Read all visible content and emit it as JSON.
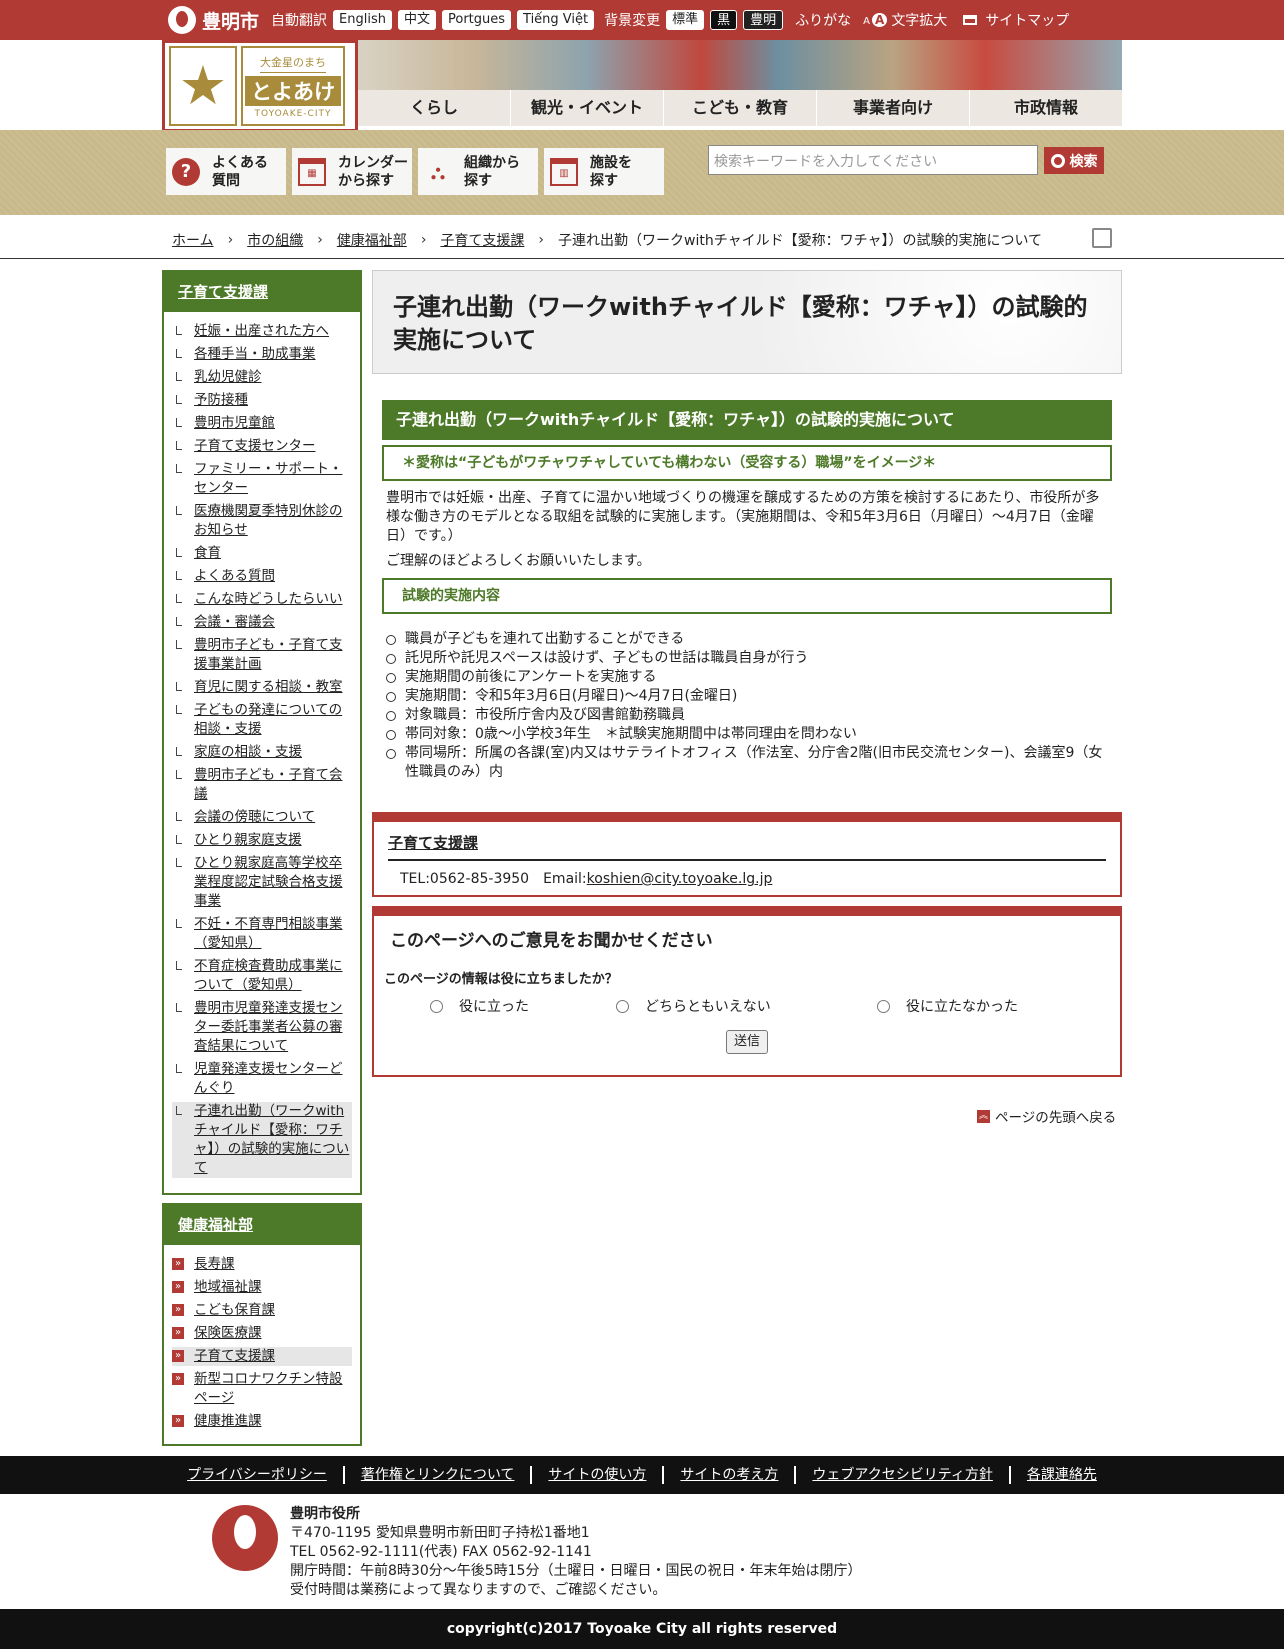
{
  "site": {
    "city": "豊明市",
    "logo_top": "大金星のまち",
    "logo_main": "とよあけ",
    "logo_sub": "TOYOAKE-CITY"
  },
  "topbar": {
    "translate_label": "自動翻訳",
    "languages": [
      "English",
      "中文",
      "Portgues",
      "Tiếng Việt"
    ],
    "bg_label": "背景変更",
    "bg_options": [
      "標準",
      "黒",
      "豊明"
    ],
    "furigana": "ふりがな",
    "zoom": "文字拡大",
    "sitemap": "サイトマップ"
  },
  "global_nav": [
    "くらし",
    "観光・イベント",
    "こども・教育",
    "事業者向け",
    "市政情報"
  ],
  "quick": [
    {
      "label": "よくある\n質問",
      "icon": "question-icon"
    },
    {
      "label": "カレンダー\nから探す",
      "icon": "calendar-icon"
    },
    {
      "label": "組織から\n探す",
      "icon": "org-chart-icon"
    },
    {
      "label": "施設を\n探す",
      "icon": "building-icon"
    }
  ],
  "search": {
    "placeholder": "検索キーワードを入力してください",
    "button": "検索"
  },
  "breadcrumb": [
    "ホーム",
    "市の組織",
    "健康福祉部",
    "子育て支援課",
    "子連れ出勤（ワークwithチャイルド【愛称：ワチャ】）の試験的実施について"
  ],
  "sidebar1": {
    "title": "子育て支援課",
    "items": [
      "妊娠・出産された方へ",
      "各種手当・助成事業",
      "乳幼児健診",
      "予防接種",
      "豊明市児童館",
      "子育て支援センター",
      "ファミリー・サポート・センター",
      "医療機関夏季特別休診のお知らせ",
      "食育",
      "よくある質問",
      "こんな時どうしたらいい",
      "会議・審議会",
      "豊明市子ども・子育て支援事業計画",
      "育児に関する相談・教室",
      "子どもの発達についての相談・支援",
      "家庭の相談・支援",
      "豊明市子ども・子育て会議",
      "会議の傍聴について",
      "ひとり親家庭支援",
      "ひとり親家庭高等学校卒業程度認定試験合格支援事業",
      "不妊・不育専門相談事業（愛知県）",
      "不育症検査費助成事業について（愛知県）",
      "豊明市児童発達支援センター委託事業者公募の審査結果について",
      "児童発達支援センターどんぐり",
      "子連れ出勤（ワークwithチャイルド【愛称：ワチャ】）の試験的実施について"
    ]
  },
  "sidebar2": {
    "title": "健康福祉部",
    "items": [
      "長寿課",
      "地域福祉課",
      "こども保育課",
      "保険医療課",
      "子育て支援課",
      "新型コロナワクチン特設ページ",
      "健康推進課"
    ]
  },
  "page": {
    "title": "子連れ出勤（ワークwithチャイルド【愛称：ワチャ】）の試験的実施について",
    "h2": "子連れ出勤（ワークwithチャイルド【愛称：ワチャ】）の試験的実施について",
    "h3a": "＊愛称は“子どもがワチャワチャしていても構わない（受容する）職場”をイメージ＊",
    "p1": "豊明市では妊娠・出産、子育てに温かい地域づくりの機運を醸成するための方策を検討するにあたり、市役所が多様な働き方のモデルとなる取組を試験的に実施します。（実施期間は、令和5年3月6日（月曜日）～4月7日（金曜日）です。）",
    "p2": "ご理解のほどよろしくお願いいたします。",
    "h3b": "試験的実施内容",
    "bullets": [
      "職員が子どもを連れて出勤することができる",
      "託児所や託児スペースは設けず、子どもの世話は職員自身が行う",
      "実施期間の前後にアンケートを実施する",
      "実施期間：令和5年3月6日(月曜日)～4月7日(金曜日)",
      "対象職員：市役所庁舎内及び図書館勤務職員",
      "帯同対象：0歳～小学校3年生　＊試験実施期間中は帯同理由を問わない",
      "帯同場所：所属の各課(室)内又はサテライトオフィス（作法室、分庁舎2階(旧市民交流センター)、会議室9（女性職員のみ）内"
    ]
  },
  "contact": {
    "name": "子育て支援課",
    "tel": "TEL:0562-85-3950　Email:",
    "email": "koshien@city.toyoake.lg.jp"
  },
  "feedback": {
    "heading": "このページへのご意見をお聞かせください",
    "question": "このページの情報は役に立ちましたか？",
    "options": [
      "役に立った",
      "どちらともいえない",
      "役に立たなかった"
    ],
    "submit": "送信"
  },
  "to_top": "ページの先頭へ戻る",
  "footer_nav": [
    "プライバシーポリシー",
    "著作権とリンクについて",
    "サイトの使い方",
    "サイトの考え方",
    "ウェブアクセシビリティ方針",
    "各課連絡先"
  ],
  "footer": {
    "org": "豊明市役所",
    "address": "〒470-1195 愛知県豊明市新田町子持松1番地1",
    "tel": "TEL 0562-92-1111(代表) FAX 0562-92-1141",
    "hours": "開庁時間：午前8時30分～午後5時15分（土曜日・日曜日・国民の祝日・年末年始は閉庁）",
    "note": "受付時間は業務によって異なりますので、ご確認ください。",
    "copyright": "copyright(c)2017 Toyoake City all rights reserved"
  }
}
